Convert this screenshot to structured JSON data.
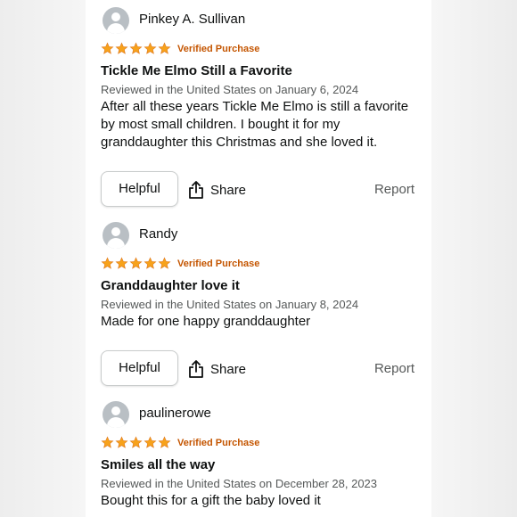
{
  "colors": {
    "star": "#f7a21b",
    "verified": "#c45500",
    "meta": "#565959"
  },
  "icons": {
    "avatar": "user-avatar-icon",
    "star": "star-icon",
    "share": "share-icon"
  },
  "reviews": [
    {
      "name": "Pinkey A. Sullivan",
      "rating": 5,
      "verified": "Verified Purchase",
      "title": "Tickle Me Elmo Still a Favorite",
      "meta": "Reviewed in the United States on January 6, 2024",
      "body": "After all these years Tickle Me Elmo is still a favorite by most small children. I bought it for my granddaughter this Christmas and she loved it.",
      "helpful_label": "Helpful",
      "share_label": "Share",
      "report_label": "Report"
    },
    {
      "name": "Randy",
      "rating": 5,
      "verified": "Verified Purchase",
      "title": "Granddaughter love it",
      "meta": "Reviewed in the United States on January 8, 2024",
      "body": "Made for one happy granddaughter",
      "helpful_label": "Helpful",
      "share_label": "Share",
      "report_label": "Report"
    },
    {
      "name": "paulinerowe",
      "rating": 5,
      "verified": "Verified Purchase",
      "title": "Smiles all the way",
      "meta": "Reviewed in the United States on December 28, 2023",
      "body": "Bought this for a gift the baby loved it"
    }
  ]
}
